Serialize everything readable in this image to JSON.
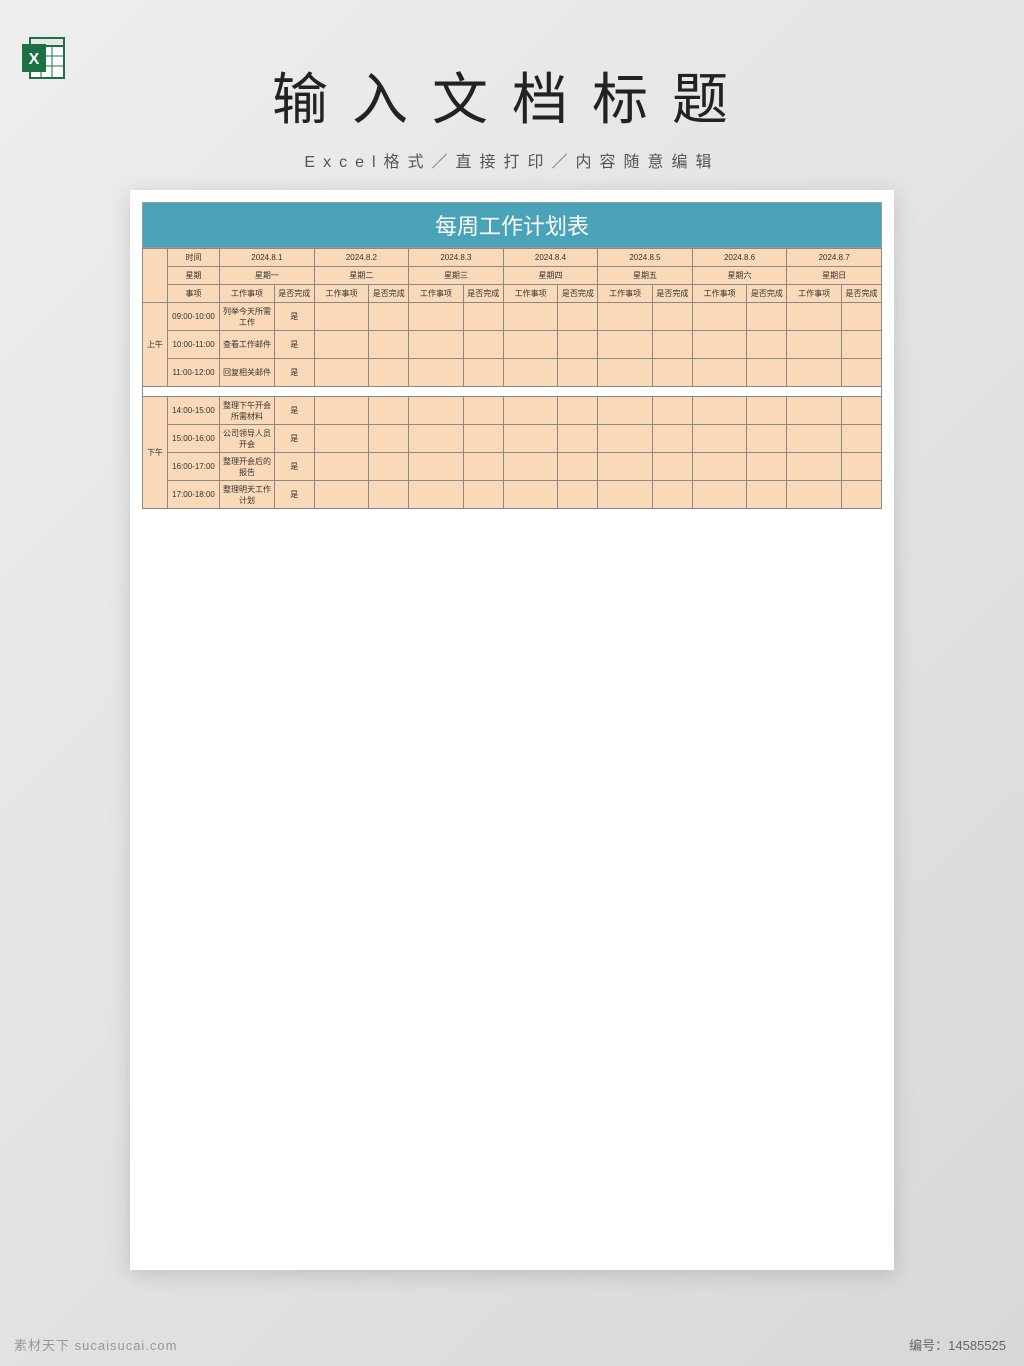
{
  "header": {
    "main_title": "输入文档标题",
    "subtitle": "Excel格式／直接打印／内容随意编辑"
  },
  "sheet": {
    "title": "每周工作计划表",
    "row_labels": {
      "time": "时间",
      "weekday": "星期",
      "item": "事项"
    },
    "col_sub": {
      "task": "工作事项",
      "done": "是否完成"
    },
    "dates": [
      "2024.8.1",
      "2024.8.2",
      "2024.8.3",
      "2024.8.4",
      "2024.8.5",
      "2024.8.6",
      "2024.8.7"
    ],
    "weekdays": [
      "星期一",
      "星期二",
      "星期三",
      "星期四",
      "星期五",
      "星期六",
      "星期日"
    ],
    "sections": {
      "morning": "上午",
      "afternoon": "下午"
    },
    "morning_rows": [
      {
        "time": "09:00-10:00",
        "task": "列举今天所需工作",
        "done": "是"
      },
      {
        "time": "10:00-11:00",
        "task": "查看工作邮件",
        "done": "是"
      },
      {
        "time": "11:00-12:00",
        "task": "回复相关邮件",
        "done": "是"
      }
    ],
    "afternoon_rows": [
      {
        "time": "14:00-15:00",
        "task": "整理下午开会所需材料",
        "done": "是"
      },
      {
        "time": "15:00-16:00",
        "task": "公司领导人员开会",
        "done": "是"
      },
      {
        "time": "16:00-17:00",
        "task": "整理开会后的报告",
        "done": "是"
      },
      {
        "time": "17:00-18:00",
        "task": "整理明天工作计划",
        "done": "是"
      }
    ]
  },
  "footer": {
    "watermark": "素材天下 sucaisucai.com",
    "id_label": "编号：",
    "id_value": "14585525"
  }
}
